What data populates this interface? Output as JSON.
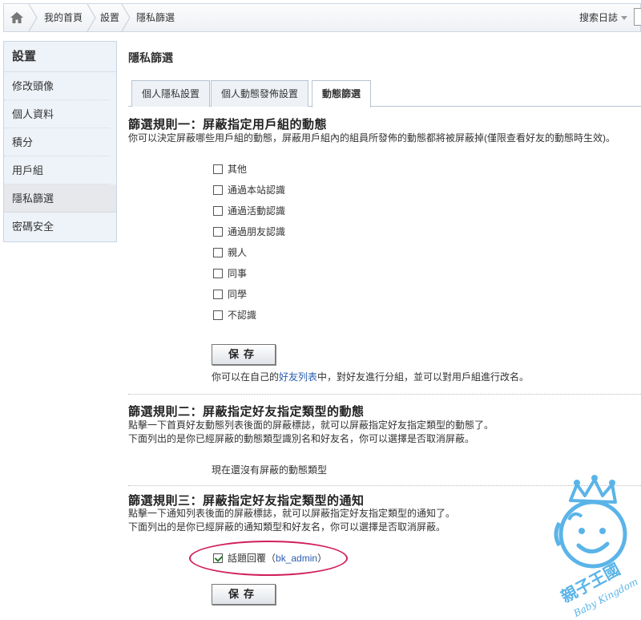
{
  "breadcrumb": {
    "home_icon": "home-icon",
    "items": [
      "我的首頁",
      "設置",
      "隱私篩選"
    ]
  },
  "header": {
    "search_blog_label": "搜索日誌"
  },
  "sidebar": {
    "title": "設置",
    "items": [
      {
        "label": "修改頭像"
      },
      {
        "label": "個人資料"
      },
      {
        "label": "積分"
      },
      {
        "label": "用戶組"
      },
      {
        "label": "隱私篩選",
        "active": true
      },
      {
        "label": "密碼安全"
      }
    ]
  },
  "main": {
    "title": "隱私篩選",
    "tabs": [
      {
        "label": "個人隱私設置"
      },
      {
        "label": "個人動態發佈設置"
      },
      {
        "label": "動態篩選",
        "active": true
      }
    ],
    "rule1": {
      "title": "篩選規則一：屏蔽指定用戶組的動態",
      "desc": "你可以決定屏蔽哪些用戶組的動態，屏蔽用戶組內的組員所發佈的動態都將被屏蔽掉(僅限查看好友的動態時生效)。",
      "groups": [
        "其他",
        "通過本站認識",
        "通過活動認識",
        "通過朋友認識",
        "親人",
        "同事",
        "同學",
        "不認識"
      ],
      "save_label": "保存",
      "note_prefix": "你可以在自己的",
      "note_link": "好友列表",
      "note_suffix": "中，對好友進行分組，並可以對用戶組進行改名。"
    },
    "rule2": {
      "title": "篩選規則二：屏蔽指定好友指定類型的動態",
      "desc_line1": "點擊一下首頁好友動態列表後面的屏蔽標誌，就可以屏蔽指定好友指定類型的動態了。",
      "desc_line2": "下面列出的是你已經屏蔽的動態類型識別名和好友名，你可以選擇是否取消屏蔽。",
      "empty_text": "現在還沒有屏蔽的動態類型"
    },
    "rule3": {
      "title": "篩選規則三：屏蔽指定好友指定類型的通知",
      "desc_line1": "點擊一下通知列表後面的屏蔽標誌，就可以屏蔽指定好友指定類型的通知了。",
      "desc_line2": "下面列出的是你已經屏蔽的通知類型和好友名，你可以選擇是否取消屏蔽。",
      "blocked_item_label": "話題回覆",
      "blocked_item_user": "bk_admin",
      "blocked_item_checked": true,
      "save_label": "保存"
    }
  },
  "watermark": {
    "brand": "親子王國",
    "brand_en": "Baby Kingdom"
  },
  "colors": {
    "link": "#2a5db0",
    "highlight": "#d0205a",
    "watermark": "#5ab4e8",
    "sidebar_bg": "#eef3f9"
  }
}
